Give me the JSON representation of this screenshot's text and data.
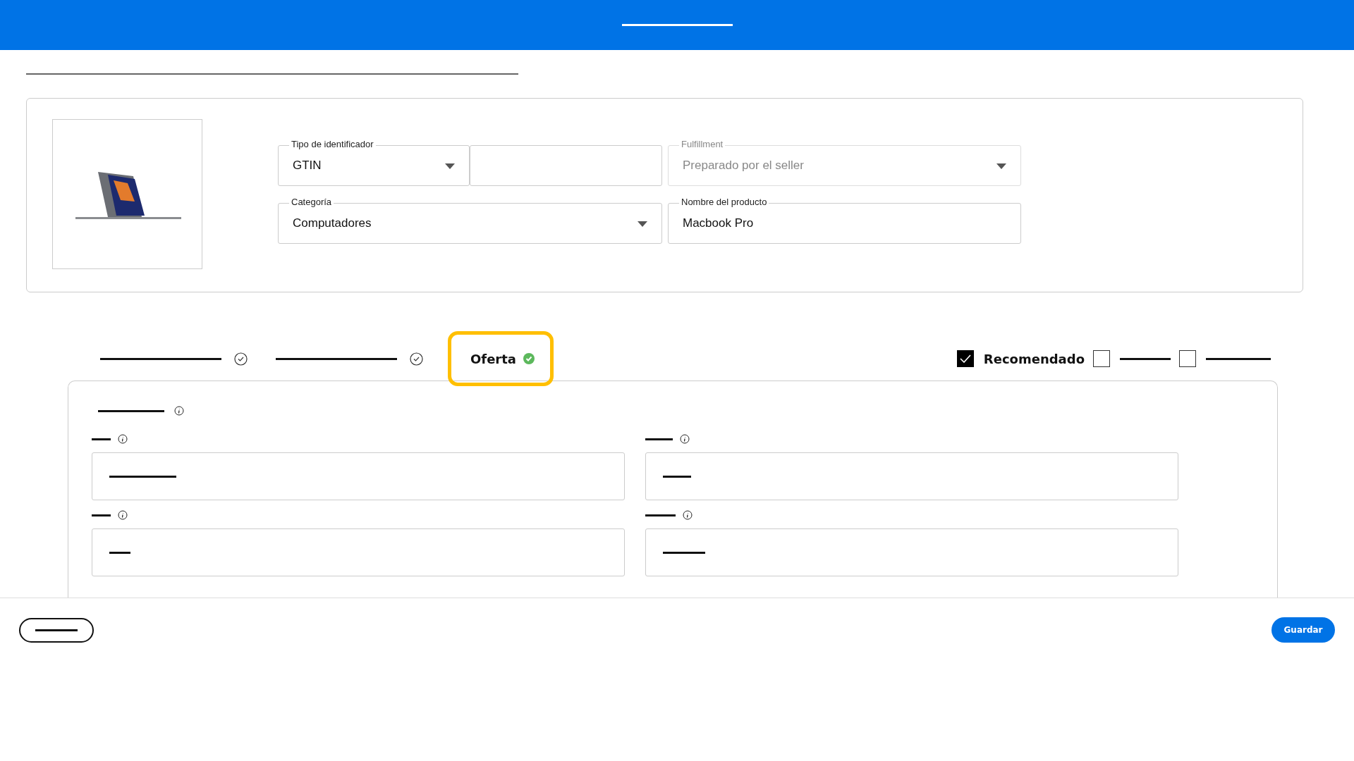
{
  "product_fields": [
    {
      "label": "Tipo de identificador",
      "value": "GTIN",
      "kind": "select",
      "disabled": false
    },
    {
      "kind": "text",
      "disabled": false
    },
    {
      "label": "Fulfillment",
      "value": "Preparado por el seller",
      "kind": "select",
      "disabled": true
    },
    {
      "label": "Categoría",
      "value": "Computadores",
      "kind": "select",
      "disabled": false
    },
    {
      "label": "Nombre del producto",
      "value": "Macbook Pro",
      "kind": "text",
      "disabled": false
    }
  ],
  "tabs": [
    {
      "selected": false,
      "complete": true
    },
    {
      "selected": false,
      "complete": true
    },
    {
      "label": "Oferta",
      "selected": true,
      "complete": true
    }
  ],
  "options": [
    {
      "label": "Recomendado",
      "checked": true
    },
    {
      "checked": false
    },
    {
      "checked": false
    }
  ],
  "offer_fields": [
    {
      "kind": "text"
    },
    {
      "kind": "text"
    },
    {
      "kind": "text"
    },
    {
      "kind": "text"
    }
  ],
  "footer_buttons": [
    {
      "kind": "secondary"
    },
    {
      "kind": "primary",
      "label": "Guardar"
    }
  ]
}
